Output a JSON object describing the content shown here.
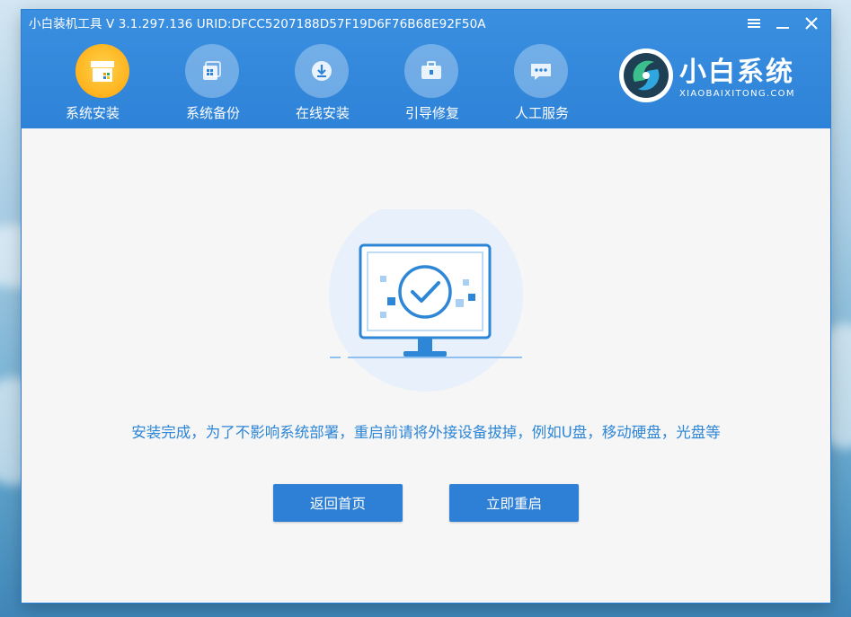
{
  "window": {
    "title": "小白装机工具 V 3.1.297.136 URID:DFCC5207188D57F19D6F76B68E92F50A"
  },
  "controls": {
    "menu_icon": "hamburger-menu-icon",
    "minimize_icon": "minimize-icon",
    "close_icon": "close-icon"
  },
  "nav": {
    "items": [
      {
        "label": "系统安装",
        "icon": "system-install-icon",
        "active": true
      },
      {
        "label": "系统备份",
        "icon": "system-backup-icon",
        "active": false
      },
      {
        "label": "在线安装",
        "icon": "online-install-icon",
        "active": false
      },
      {
        "label": "引导修复",
        "icon": "boot-repair-icon",
        "active": false
      },
      {
        "label": "人工服务",
        "icon": "chat-service-icon",
        "active": false
      }
    ]
  },
  "brand": {
    "name": "小白系统",
    "subtitle": "XIAOBAIXITONG.COM",
    "logo_icon": "xiaobai-logo-icon"
  },
  "main": {
    "illustration_icon": "monitor-checkmark-icon",
    "message": "安装完成，为了不影响系统部署，重启前请将外接设备拔掉，例如U盘，移动硬盘，光盘等",
    "home_button": "返回首页",
    "restart_button": "立即重启"
  },
  "colors": {
    "header_blue": "#2e83d8",
    "accent_blue": "#2e80d6",
    "active_nav": "#ffb21c",
    "message_text": "#2e86d6"
  }
}
